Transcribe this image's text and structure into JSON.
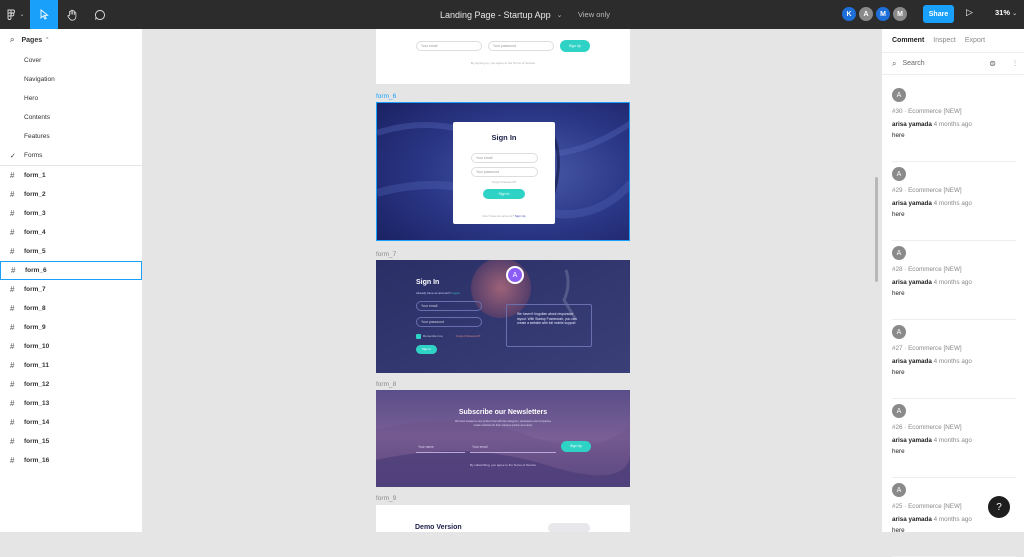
{
  "topbar": {
    "file_title": "Landing Page - Startup App",
    "view_only": "View only",
    "share_label": "Share",
    "zoom": "31%",
    "avatars": [
      {
        "letter": "K",
        "color": "#1e6fd9"
      },
      {
        "letter": "A",
        "color": "#8a8a8a"
      },
      {
        "letter": "M",
        "color": "#1e6fd9"
      },
      {
        "letter": "M",
        "color": "#8a8a8a"
      }
    ],
    "icons": [
      "figma-menu-icon",
      "move-tool-icon",
      "hand-tool-icon",
      "comment-tool-icon",
      "present-icon"
    ]
  },
  "left_panel": {
    "pages_label": "Pages",
    "pages": [
      {
        "label": "Cover",
        "current": false
      },
      {
        "label": "Navigation",
        "current": false
      },
      {
        "label": "Hero",
        "current": false
      },
      {
        "label": "Contents",
        "current": false
      },
      {
        "label": "Features",
        "current": false
      },
      {
        "label": "Forms",
        "current": true
      }
    ],
    "layers": [
      "form_1",
      "form_2",
      "form_3",
      "form_4",
      "form_5",
      "form_6",
      "form_7",
      "form_8",
      "form_9",
      "form_10",
      "form_11",
      "form_12",
      "form_13",
      "form_14",
      "form_15",
      "form_16"
    ],
    "selected_layer": "form_6"
  },
  "canvas": {
    "top_form": {
      "email_placeholder": "Your email",
      "password_placeholder": "Your password",
      "button": "Sign Up",
      "note": "By signing up, you agree to the Terms of Service"
    },
    "form_6": {
      "label": "form_6",
      "title": "Sign In",
      "email_placeholder": "Your email",
      "password_placeholder": "Your password",
      "forgot": "Forgot Password?",
      "button": "Sign In",
      "note": "Don't have an account?",
      "note_link": "Sign Up"
    },
    "form_7": {
      "label": "form_7",
      "title": "Sign In",
      "subtitle": "Already have an account?",
      "subtitle_link": "Log In",
      "email_placeholder": "Your email",
      "password_placeholder": "Your password",
      "remember": "Remember me",
      "forgot": "Forgot Password?",
      "button": "Sign In",
      "avatar_letter": "A",
      "card_text": "We haven't forgotten about responsive layout. With Startup Framework, you can create a website with full mobile support."
    },
    "form_8": {
      "label": "form_8",
      "title": "Subscribe our Newsletters",
      "subtitle": "We have created a new product that will help designers, developers and companies create websites for their startups quickly and easily.",
      "name_placeholder": "Your name",
      "email_placeholder": "Your email",
      "button": "Sign Up",
      "note": "By subscribing, you agree to the Terms of Service"
    },
    "form_9": {
      "label": "form_9",
      "title": "Demo Version"
    }
  },
  "right_panel": {
    "tabs": [
      "Comment",
      "Inspect",
      "Export"
    ],
    "active_tab": "Comment",
    "search_placeholder": "Search",
    "comments": [
      {
        "avatar": "A",
        "meta": "#30 · Ecommerce [NEW]",
        "author": "arisa yamada",
        "time": "4 months ago",
        "text": "here"
      },
      {
        "avatar": "A",
        "meta": "#29 · Ecommerce [NEW]",
        "author": "arisa yamada",
        "time": "4 months ago",
        "text": "here"
      },
      {
        "avatar": "A",
        "meta": "#28 · Ecommerce [NEW]",
        "author": "arisa yamada",
        "time": "4 months ago",
        "text": "here"
      },
      {
        "avatar": "A",
        "meta": "#27 · Ecommerce [NEW]",
        "author": "arisa yamada",
        "time": "4 months ago",
        "text": "here"
      },
      {
        "avatar": "A",
        "meta": "#26 · Ecommerce [NEW]",
        "author": "arisa yamada",
        "time": "4 months ago",
        "text": "here"
      },
      {
        "avatar": "A",
        "meta": "#25 · Ecommerce [NEW]",
        "author": "arisa yamada",
        "time": "4 months ago",
        "text": "here"
      }
    ]
  },
  "help_label": "?",
  "colors": {
    "accent": "#18a0fb",
    "teal": "#2fd3c6",
    "form_bg_dark": "#2c3470",
    "topbar": "#2c2c2c"
  }
}
